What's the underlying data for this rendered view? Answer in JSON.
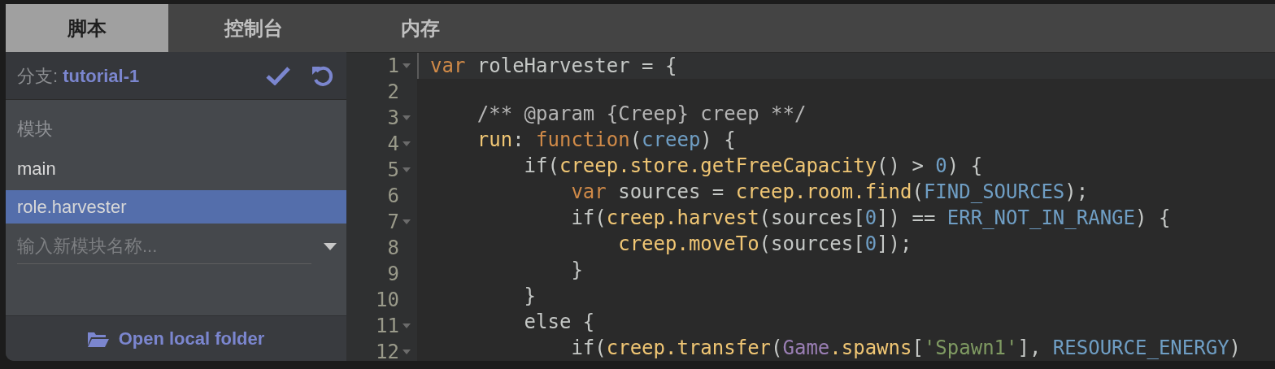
{
  "tabs": [
    {
      "label": "脚本",
      "selected": true
    },
    {
      "label": "控制台",
      "selected": false
    },
    {
      "label": "内存",
      "selected": false
    }
  ],
  "branch": {
    "label": "分支:",
    "name": "tutorial-1"
  },
  "modules": {
    "heading": "模块",
    "items": [
      {
        "label": "main",
        "selected": false
      },
      {
        "label": "role.harvester",
        "selected": true
      }
    ],
    "new_module": {
      "placeholder": "输入新模块名称..."
    }
  },
  "footer": {
    "button": "Open local folder"
  },
  "editor": {
    "lines": [
      {
        "number": "1",
        "fold": true,
        "active": true,
        "tokens": [
          {
            "kind": "kw",
            "text": "var"
          },
          {
            "kind": "plain",
            "text": " roleHarvester = {"
          }
        ]
      },
      {
        "number": "2",
        "fold": false,
        "active": false
      },
      {
        "number": "3",
        "fold": true,
        "active": false,
        "tokens": [
          {
            "kind": "comment",
            "text": "    /** @param {Creep} creep **/"
          }
        ]
      },
      {
        "number": "4",
        "fold": true,
        "active": false,
        "tokens": [
          {
            "kind": "fn",
            "text": "    run"
          },
          {
            "kind": "plain",
            "text": ": "
          },
          {
            "kind": "kw",
            "text": "function"
          },
          {
            "kind": "plain",
            "text": "("
          },
          {
            "kind": "var",
            "text": "creep"
          },
          {
            "kind": "plain",
            "text": ") {"
          }
        ]
      },
      {
        "number": "5",
        "fold": true,
        "active": false,
        "tokens": [
          {
            "kind": "plain",
            "text": "        if("
          },
          {
            "kind": "fn",
            "text": "creep.store.getFreeCapacity"
          },
          {
            "kind": "plain",
            "text": "() > "
          },
          {
            "kind": "var",
            "text": "0"
          },
          {
            "kind": "plain",
            "text": ") {"
          }
        ]
      },
      {
        "number": "6",
        "fold": false,
        "active": false,
        "tokens": [
          {
            "kind": "kw",
            "text": "            var"
          },
          {
            "kind": "plain",
            "text": " sources = "
          },
          {
            "kind": "fn",
            "text": "creep.room.find"
          },
          {
            "kind": "plain",
            "text": "("
          },
          {
            "kind": "var",
            "text": "FIND_SOURCES"
          },
          {
            "kind": "plain",
            "text": ");"
          }
        ]
      },
      {
        "number": "7",
        "fold": true,
        "active": false,
        "tokens": [
          {
            "kind": "plain",
            "text": "            if("
          },
          {
            "kind": "fn",
            "text": "creep.harvest"
          },
          {
            "kind": "plain",
            "text": "(sources["
          },
          {
            "kind": "var",
            "text": "0"
          },
          {
            "kind": "plain",
            "text": "]) == "
          },
          {
            "kind": "var",
            "text": "ERR_NOT_IN_RANGE"
          },
          {
            "kind": "plain",
            "text": ") {"
          }
        ]
      },
      {
        "number": "8",
        "fold": false,
        "active": false,
        "tokens": [
          {
            "kind": "fn",
            "text": "                creep.moveTo"
          },
          {
            "kind": "plain",
            "text": "(sources["
          },
          {
            "kind": "var",
            "text": "0"
          },
          {
            "kind": "plain",
            "text": "]);"
          }
        ]
      },
      {
        "number": "9",
        "fold": false,
        "active": false,
        "tokens": [
          {
            "kind": "plain",
            "text": "            }"
          }
        ]
      },
      {
        "number": "10",
        "fold": false,
        "active": false,
        "tokens": [
          {
            "kind": "plain",
            "text": "        }"
          }
        ]
      },
      {
        "number": "11",
        "fold": true,
        "active": false,
        "tokens": [
          {
            "kind": "plain",
            "text": "        else {"
          }
        ]
      },
      {
        "number": "12",
        "fold": true,
        "active": false,
        "tokens": [
          {
            "kind": "plain",
            "text": "            if("
          },
          {
            "kind": "fn",
            "text": "creep.transfer"
          },
          {
            "kind": "plain",
            "text": "("
          },
          {
            "kind": "global",
            "text": "Game"
          },
          {
            "kind": "fn",
            "text": ".spawns"
          },
          {
            "kind": "plain",
            "text": "["
          },
          {
            "kind": "str",
            "text": "'Spawn1'"
          },
          {
            "kind": "plain",
            "text": "], "
          },
          {
            "kind": "var",
            "text": "RESOURCE_ENERGY"
          },
          {
            "kind": "plain",
            "text": ")"
          }
        ]
      }
    ]
  }
}
